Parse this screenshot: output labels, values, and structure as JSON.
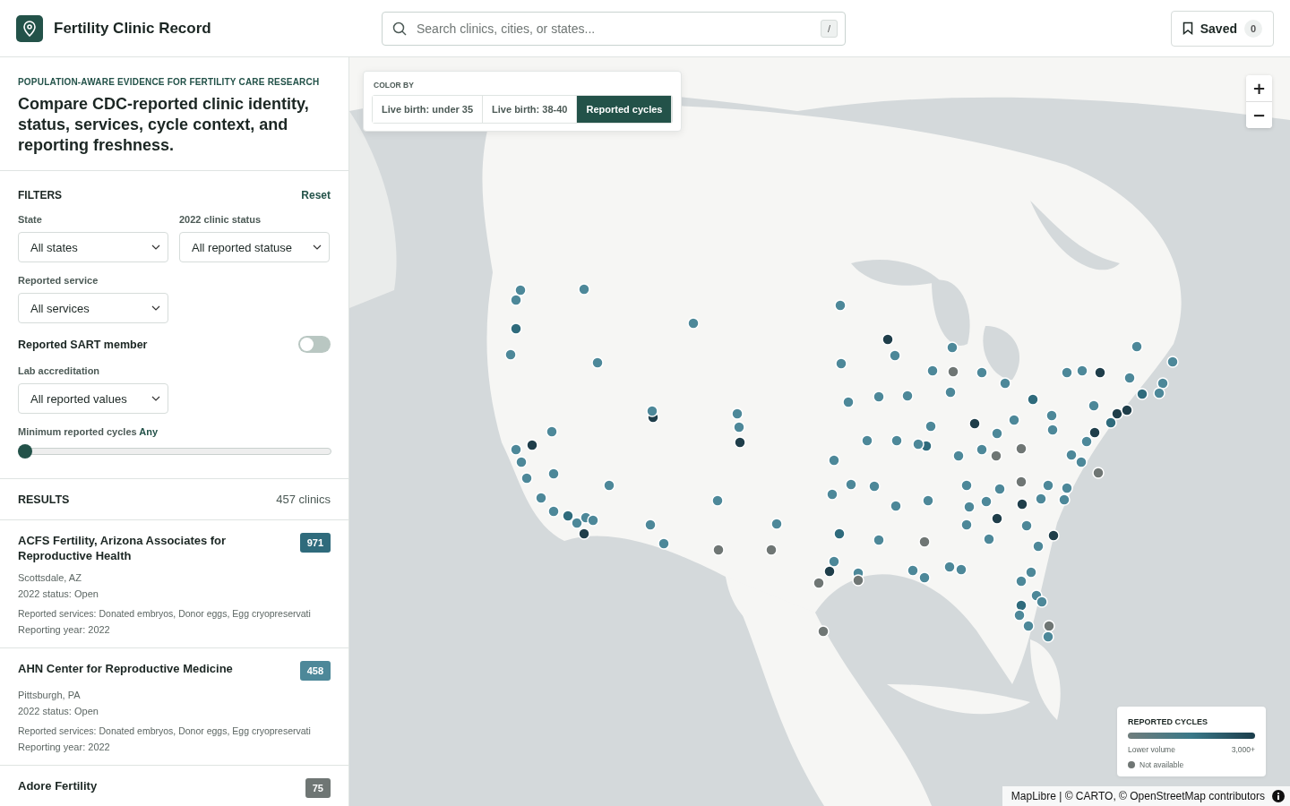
{
  "header": {
    "title": "Fertility Clinic Record",
    "search": {
      "placeholder": "Search clinics, cities, or states...",
      "shortcut": "/"
    },
    "saved": {
      "label": "Saved",
      "count": "0"
    }
  },
  "intro": {
    "eyebrow": "POPULATION-AWARE EVIDENCE FOR FERTILITY CARE RESEARCH",
    "headline": "Compare CDC-reported clinic identity, status, services, cycle context, and reporting freshness."
  },
  "filters": {
    "title": "FILTERS",
    "reset": "Reset",
    "items": [
      {
        "kind": "select",
        "label": "State",
        "value": "All states"
      },
      {
        "kind": "select",
        "label": "2022 clinic status",
        "value": "All reported statuse"
      },
      {
        "kind": "select",
        "label": "Reported service",
        "value": "All services"
      },
      {
        "kind": "toggle",
        "label": "Reported SART member",
        "on": false
      },
      {
        "kind": "select",
        "label": "Lab accreditation",
        "value": "All reported values"
      },
      {
        "kind": "slider",
        "label": "Minimum reported cycles",
        "reading": "Any",
        "level": 0
      }
    ]
  },
  "results": {
    "title": "RESULTS",
    "count": "457 clinics",
    "items": [
      {
        "name": "ACFS Fertility, Arizona Associates for Reproductive Health",
        "cycles": "971",
        "color": "#2f6b7c",
        "location": "Scottsdale, AZ",
        "status": "2022 status: Open",
        "services": "Reported services: Donated embryos, Donor eggs, Egg cryopreservati",
        "year": "Reporting year: 2022"
      },
      {
        "name": "AHN Center for Reproductive Medicine",
        "cycles": "458",
        "color": "#4d8899",
        "location": "Pittsburgh, PA",
        "status": "2022 status: Open",
        "services": "Reported services: Donated embryos, Donor eggs, Egg cryopreservati",
        "year": "Reporting year: 2022"
      },
      {
        "name": "Adore Fertility",
        "cycles": "75",
        "color": "#6f7674"
      }
    ]
  },
  "map": {
    "color_by": {
      "title": "COLOR BY",
      "options": [
        {
          "label": "Live birth: under 35",
          "selected": false
        },
        {
          "label": "Live birth: 38-40",
          "selected": false
        },
        {
          "label": "Reported cycles",
          "selected": true
        }
      ]
    },
    "zoom": {
      "in": "+",
      "out": "−"
    },
    "legend": {
      "title": "REPORTED CYCLES",
      "low": "Lower volume",
      "high": "3,000+",
      "na": "Not available"
    },
    "attribution": "MapLibre | © CARTO, © OpenStreetMap contributors"
  }
}
